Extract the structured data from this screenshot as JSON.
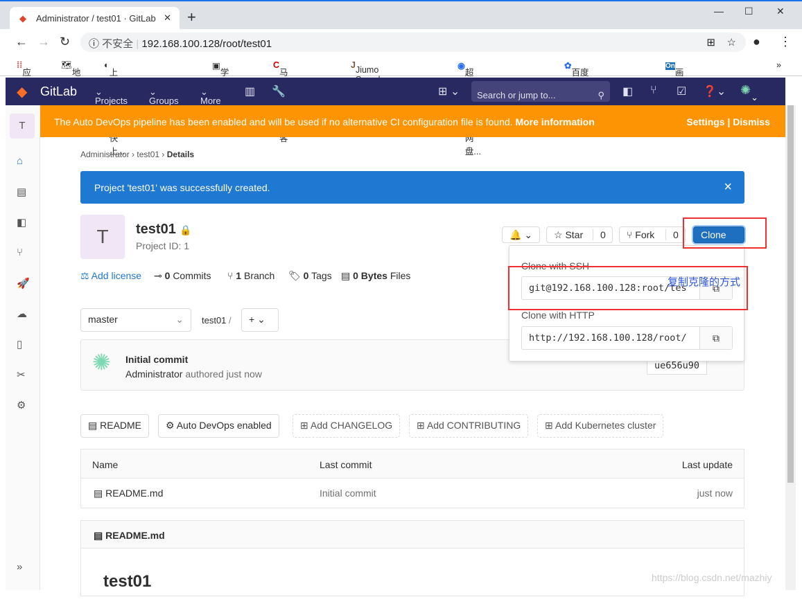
{
  "browser": {
    "tab_title": "Administrator / test01 · GitLab",
    "insecure": "不安全",
    "url": "192.168.100.128/root/test01",
    "bookmarks": [
      "应用",
      "地图",
      "上网导航 - 轻快上...",
      "学生平台",
      "马治个人博客",
      "Jiumo Search 鸠摩...",
      "超能搜 - 百度网盘...",
      "百度一下，你就知道",
      "画图"
    ]
  },
  "nav": {
    "brand": "GitLab",
    "projects": "Projects",
    "groups": "Groups",
    "more": "More",
    "search_placeholder": "Search or jump to..."
  },
  "sidebar": {
    "project_letter": "T"
  },
  "banner": {
    "text": "The Auto DevOps pipeline has been enabled and will be used if no alternative CI configuration file is found.",
    "link": "More information",
    "settings": "Settings",
    "sep": "|",
    "dismiss": "Dismiss"
  },
  "breadcrumb": [
    "Administrator",
    "test01",
    "Details"
  ],
  "flash": {
    "text": "Project 'test01' was successfully created.",
    "close": "×"
  },
  "project": {
    "avatar": "T",
    "name": "test01",
    "id": "Project ID: 1",
    "star": "Star",
    "star_count": "0",
    "fork": "Fork",
    "fork_count": "0",
    "clone": "Clone"
  },
  "stats": {
    "add_license": "Add license",
    "commits_n": "0",
    "commits": "Commits",
    "branch_n": "1",
    "branch": "Branch",
    "tags_n": "0",
    "tags": "Tags",
    "bytes_n": "0 Bytes",
    "files": "Files"
  },
  "clone_menu": {
    "ssh_label": "Clone with SSH",
    "ssh_url": "git@192.168.100.128:root/tes",
    "http_label": "Clone with HTTP",
    "http_url": "http://192.168.100.128/root/",
    "annotation": "复制克隆的方式"
  },
  "repo": {
    "branch": "master",
    "path": "test01",
    "sep": "/",
    "add": "+"
  },
  "commit": {
    "title": "Initial commit",
    "author": "Administrator",
    "authored": "authored just now",
    "sha": "ue656u90"
  },
  "buttons": {
    "readme": "README",
    "autodevops": "Auto DevOps enabled",
    "changelog": "Add CHANGELOG",
    "contributing": "Add CONTRIBUTING",
    "k8s": "Add Kubernetes cluster"
  },
  "table": {
    "headers": [
      "Name",
      "Last commit",
      "Last update"
    ],
    "rows": [
      {
        "name": "README.md",
        "commit": "Initial commit",
        "update": "just now"
      }
    ]
  },
  "readme": {
    "file": "README.md",
    "heading": "test01"
  },
  "watermark": "https://blog.csdn.net/mazhiy"
}
